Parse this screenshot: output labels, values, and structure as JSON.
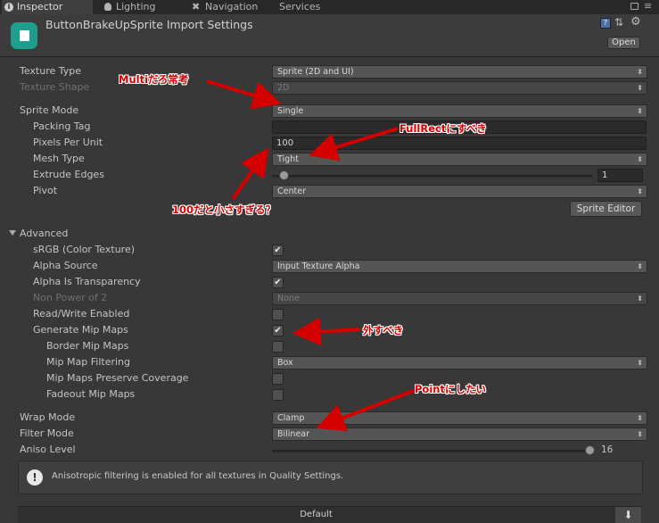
{
  "tabs": [
    "Inspector",
    "Lighting",
    "Navigation",
    "Services"
  ],
  "header": {
    "title": "ButtonBrakeUpSprite Import Settings",
    "open_label": "Open"
  },
  "fields": {
    "texture_type": {
      "label": "Texture Type",
      "value": "Sprite (2D and UI)"
    },
    "texture_shape": {
      "label": "Texture Shape",
      "value": "2D"
    },
    "sprite_mode": {
      "label": "Sprite Mode",
      "value": "Single"
    },
    "packing_tag": {
      "label": "Packing Tag",
      "value": ""
    },
    "pixels_per_unit": {
      "label": "Pixels Per Unit",
      "value": "100"
    },
    "mesh_type": {
      "label": "Mesh Type",
      "value": "Tight"
    },
    "extrude_edges": {
      "label": "Extrude Edges",
      "value": "1"
    },
    "pivot": {
      "label": "Pivot",
      "value": "Center"
    },
    "sprite_editor_label": "Sprite Editor"
  },
  "advanced": {
    "label": "Advanced",
    "srgb": {
      "label": "sRGB (Color Texture)",
      "checked": true
    },
    "alpha_source": {
      "label": "Alpha Source",
      "value": "Input Texture Alpha"
    },
    "alpha_is_transparency": {
      "label": "Alpha Is Transparency",
      "checked": true
    },
    "non_power_of_2": {
      "label": "Non Power of 2",
      "value": "None"
    },
    "read_write": {
      "label": "Read/Write Enabled",
      "checked": false
    },
    "generate_mip_maps": {
      "label": "Generate Mip Maps",
      "checked": true
    },
    "border_mip_maps": {
      "label": "Border Mip Maps",
      "checked": false
    },
    "mip_map_filtering": {
      "label": "Mip Map Filtering",
      "value": "Box"
    },
    "mip_maps_preserve_coverage": {
      "label": "Mip Maps Preserve Coverage",
      "checked": false
    },
    "fadeout_mip_maps": {
      "label": "Fadeout Mip Maps",
      "checked": false
    }
  },
  "wrap_mode": {
    "label": "Wrap Mode",
    "value": "Clamp"
  },
  "filter_mode": {
    "label": "Filter Mode",
    "value": "Bilinear"
  },
  "aniso_level": {
    "label": "Aniso Level",
    "value": "16"
  },
  "info_message": "Anisotropic filtering is enabled for all textures in Quality Settings.",
  "platform_default_label": "Default",
  "annotations": {
    "multi": "Multiだろ常考",
    "fullrect": "FullRectにすべき",
    "pixels": "100だと小さすぎる？",
    "mip": "外すべき",
    "point": "Pointにしたい"
  },
  "colors": {
    "annotation": "#d40000",
    "panel_bg": "#383838",
    "icon_teal": "#1f9d8f"
  },
  "check_glyph": "✔"
}
